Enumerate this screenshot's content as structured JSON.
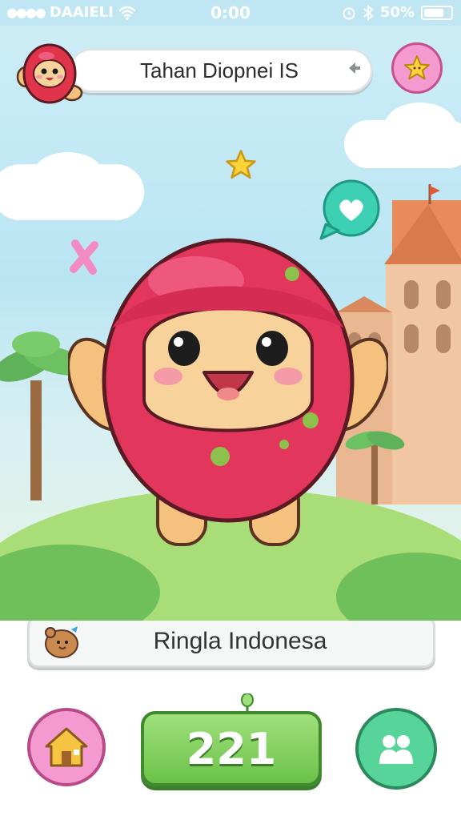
{
  "status_bar": {
    "carrier": "DAAIELI",
    "time": "0:00",
    "battery_percent": "50%",
    "battery_level": 0.5
  },
  "header": {
    "title": "Tahan Diopnei IS",
    "avatar_icon": "red-hooded-mascot-avatar",
    "back_icon": "arrow-left-icon",
    "star_icon": "star-icon"
  },
  "scene": {
    "character": "red-egg-mascot",
    "speech_icon": "heart-speech-bubble-icon"
  },
  "name_bar": {
    "name": "Ringla Indonesa",
    "icon": "bear-pet-icon"
  },
  "bottom_bar": {
    "home_icon": "house-icon",
    "score": "221",
    "friends_icon": "people-icon"
  },
  "colors": {
    "sky": "#bfe6f2",
    "pink_button": "#f49ad0",
    "green_button": "#6cc24a",
    "teal_button": "#57d49a",
    "character_red": "#e2365c"
  }
}
